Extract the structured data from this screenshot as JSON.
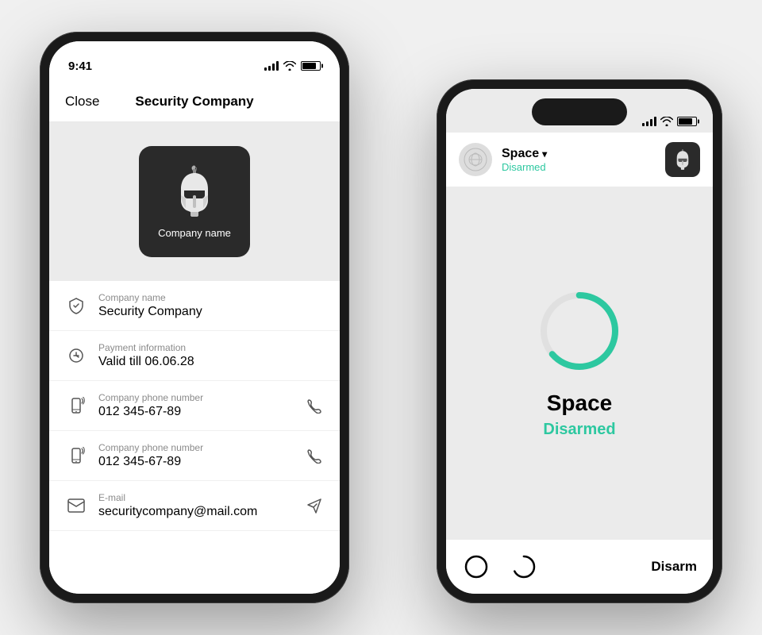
{
  "left_phone": {
    "status_bar": {
      "time": "9:41"
    },
    "nav": {
      "close_label": "Close",
      "title": "Security Company"
    },
    "logo": {
      "label": "Company name"
    },
    "info_items": [
      {
        "id": "company-name",
        "label": "Company name",
        "value": "Security Company",
        "has_action": false
      },
      {
        "id": "payment",
        "label": "Payment information",
        "value": "Valid till 06.06.28",
        "has_action": false
      },
      {
        "id": "phone1",
        "label": "Company phone number",
        "value": "012 345-67-89",
        "has_action": true
      },
      {
        "id": "phone2",
        "label": "Company phone number",
        "value": "012 345-67-89",
        "has_action": true
      },
      {
        "id": "email",
        "label": "E-mail",
        "value": "securitycompany@mail.com",
        "has_action": true
      }
    ]
  },
  "right_phone": {
    "header": {
      "space_name": "Space",
      "space_status": "Disarmed",
      "company_name": "Company name"
    },
    "main": {
      "location_name": "Space",
      "status": "Disarmed"
    },
    "bottom": {
      "disarm_label": "Disarm"
    }
  },
  "colors": {
    "teal": "#2dc8a0",
    "dark": "#2a2a2a",
    "gray_bg": "#ebebeb",
    "text_secondary": "#8a8a8a"
  }
}
